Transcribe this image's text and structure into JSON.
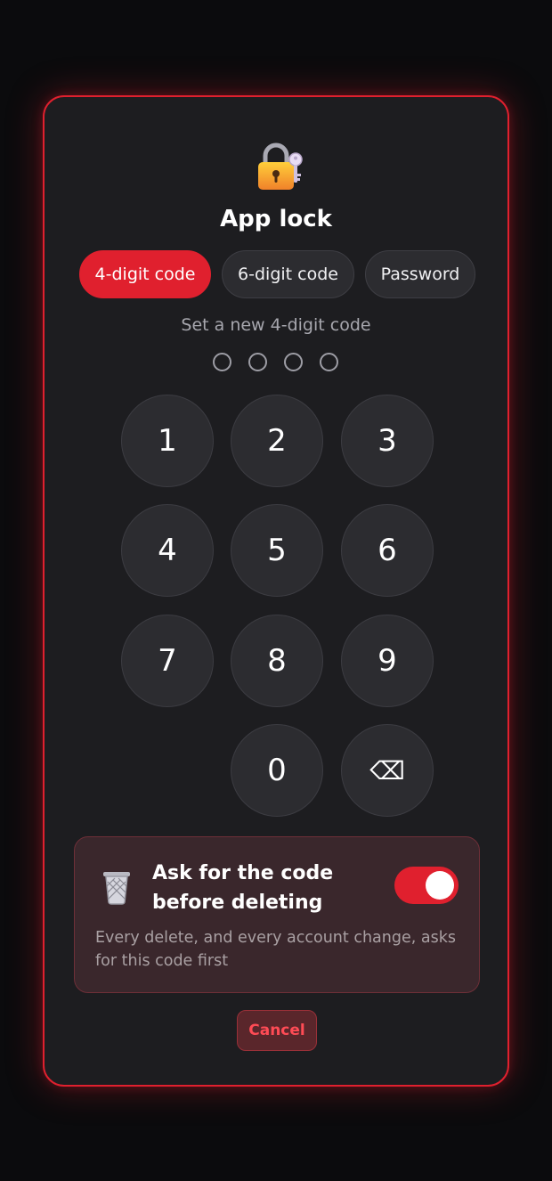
{
  "header": {
    "icon": "lock-with-key-icon",
    "title": "App lock"
  },
  "tabs": [
    {
      "label": "4-digit code",
      "active": true
    },
    {
      "label": "6-digit code",
      "active": false
    },
    {
      "label": "Password",
      "active": false
    }
  ],
  "prompt": "Set a new 4-digit code",
  "code_entry": {
    "length": 4,
    "filled": 0
  },
  "keypad": {
    "keys": [
      "1",
      "2",
      "3",
      "4",
      "5",
      "6",
      "7",
      "8",
      "9",
      "0"
    ],
    "backspace_icon": "backspace-icon",
    "backspace_glyph": "⌫"
  },
  "delete_protection": {
    "icon": "wastebasket-icon",
    "title": "Ask for the code before deleting",
    "description": "Every delete, and every account change, asks for this code first",
    "enabled": true
  },
  "cancel_label": "Cancel",
  "colors": {
    "accent": "#e0202e",
    "modal_bg": "#1d1d20",
    "key_bg": "#2c2c30",
    "card_bg": "#3a272c",
    "cancel_text": "#ff4b55"
  }
}
